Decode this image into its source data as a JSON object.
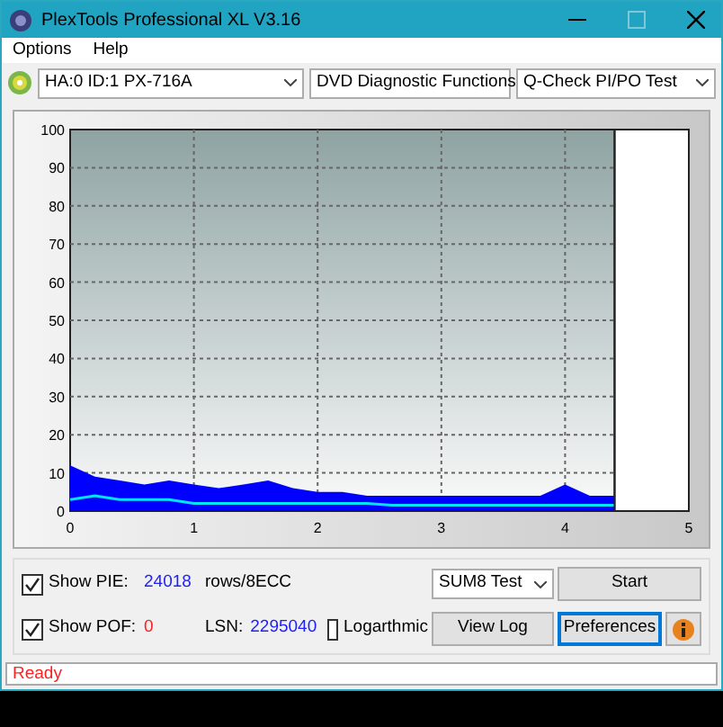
{
  "window": {
    "title": "PlexTools Professional XL V3.16"
  },
  "menu": [
    "Options",
    "Help"
  ],
  "toolbar": {
    "drive": "HA:0 ID:1  PX-716A",
    "function": "DVD Diagnostic Functions",
    "test": "Q-Check PI/PO Test"
  },
  "chart": {
    "chart_data": {
      "type": "area",
      "xlim": [
        0,
        5
      ],
      "ylim": [
        0,
        100
      ],
      "xticks": [
        0,
        1,
        2,
        3,
        4,
        5
      ],
      "yticks": [
        0,
        10,
        20,
        30,
        40,
        50,
        60,
        70,
        80,
        90,
        100
      ],
      "grid": true,
      "bands": [
        {
          "axis": "x",
          "from": 4.4,
          "to": 5,
          "color": "#ffffff"
        }
      ],
      "ref_lines": [
        {
          "axis": "x",
          "value": 4.4,
          "color": "#222222"
        }
      ],
      "x": [
        0,
        0.2,
        0.4,
        0.6,
        0.8,
        1,
        1.2,
        1.4,
        1.6,
        1.8,
        2,
        2.2,
        2.4,
        2.6,
        2.8,
        3,
        3.2,
        3.4,
        3.6,
        3.8,
        4,
        4.2,
        4.4
      ],
      "series": [
        {
          "type": "area",
          "color": "#0000ff",
          "values": [
            12,
            9,
            8,
            7,
            8,
            7,
            6,
            7,
            8,
            6,
            5,
            5,
            4,
            4,
            4,
            4,
            4,
            4,
            4,
            4,
            7,
            4,
            4
          ]
        },
        {
          "type": "line",
          "color": "#00e5ff",
          "values": [
            3,
            4,
            3,
            3,
            3,
            2,
            2,
            2,
            2,
            2,
            2,
            2,
            2,
            1.5,
            1.5,
            1.5,
            1.5,
            1.5,
            1.5,
            1.5,
            1.5,
            1.5,
            1.5
          ]
        }
      ]
    }
  },
  "controls": {
    "show_pie": {
      "label": "Show PIE:",
      "checked": true,
      "value": "24018",
      "unit": "rows/8ECC"
    },
    "show_pof": {
      "label": "Show POF:",
      "checked": true,
      "value": "0"
    },
    "lsn": {
      "label": "LSN:",
      "value": "2295040"
    },
    "logarithmic": {
      "label": "Logarthmic",
      "checked": false
    },
    "test_select": "SUM8 Test",
    "buttons": [
      {
        "label": "Start",
        "focused": false
      },
      {
        "label": "View Log",
        "focused": false
      },
      {
        "label": "Preferences",
        "focused": true
      }
    ]
  },
  "status_bar": "Ready"
}
